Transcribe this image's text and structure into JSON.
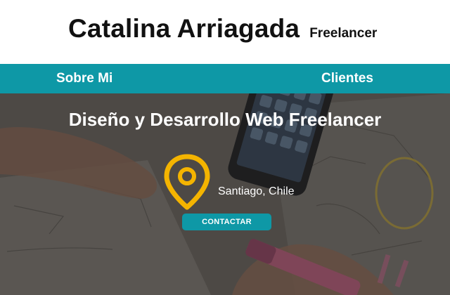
{
  "header": {
    "name": "Catalina Arriagada",
    "tagline": "Freelancer"
  },
  "nav": {
    "items": [
      {
        "label": "Sobre Mi"
      },
      {
        "label": "Clientes"
      }
    ]
  },
  "hero": {
    "title": "Diseño y Desarrollo Web Freelancer",
    "location": "Santiago, Chile",
    "location_icon": "map-pin-icon",
    "cta_label": "CONTACTAR"
  },
  "colors": {
    "accent": "#0e98a6",
    "pin": "#f4b400",
    "nav_text": "#ffffff",
    "header_bg": "#ffffff"
  }
}
